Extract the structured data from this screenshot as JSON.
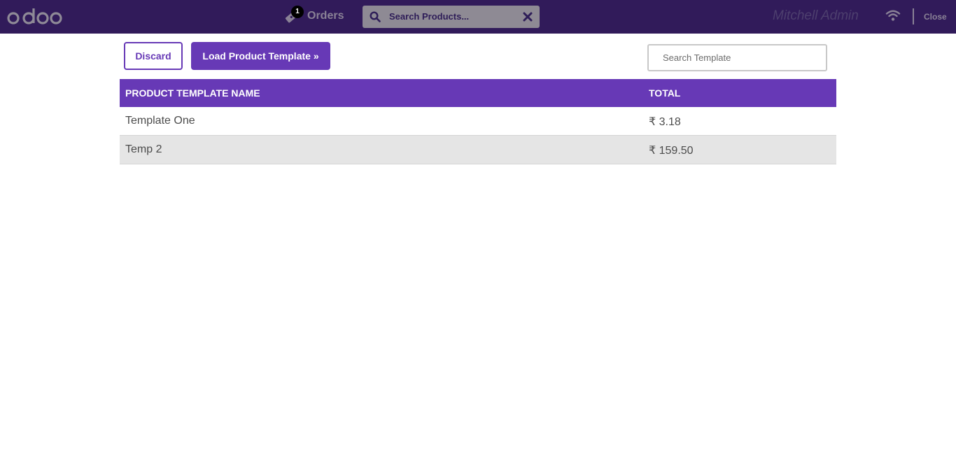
{
  "header": {
    "logo_text": "odoo",
    "orders_count": "1",
    "orders_label": "Orders",
    "product_search_placeholder": "Search Products...",
    "user_name": "Mitchell Admin",
    "close_label": "Close"
  },
  "toolbar": {
    "discard_label": "Discard",
    "load_label": "Load Product Template »",
    "template_search_placeholder": "Search Template"
  },
  "table": {
    "columns": [
      "PRODUCT TEMPLATE NAME",
      "TOTAL"
    ],
    "rows": [
      {
        "name": "Template One",
        "total": "₹ 3.18"
      },
      {
        "name": "Temp 2",
        "total": "₹ 159.50"
      }
    ]
  },
  "colors": {
    "topbar": "#311b5a",
    "accent": "#6739b6",
    "row_alt": "#e5e5e5"
  },
  "icons": [
    "odoo-logo",
    "ticket-icon",
    "search-icon",
    "close-icon",
    "wifi-icon"
  ]
}
